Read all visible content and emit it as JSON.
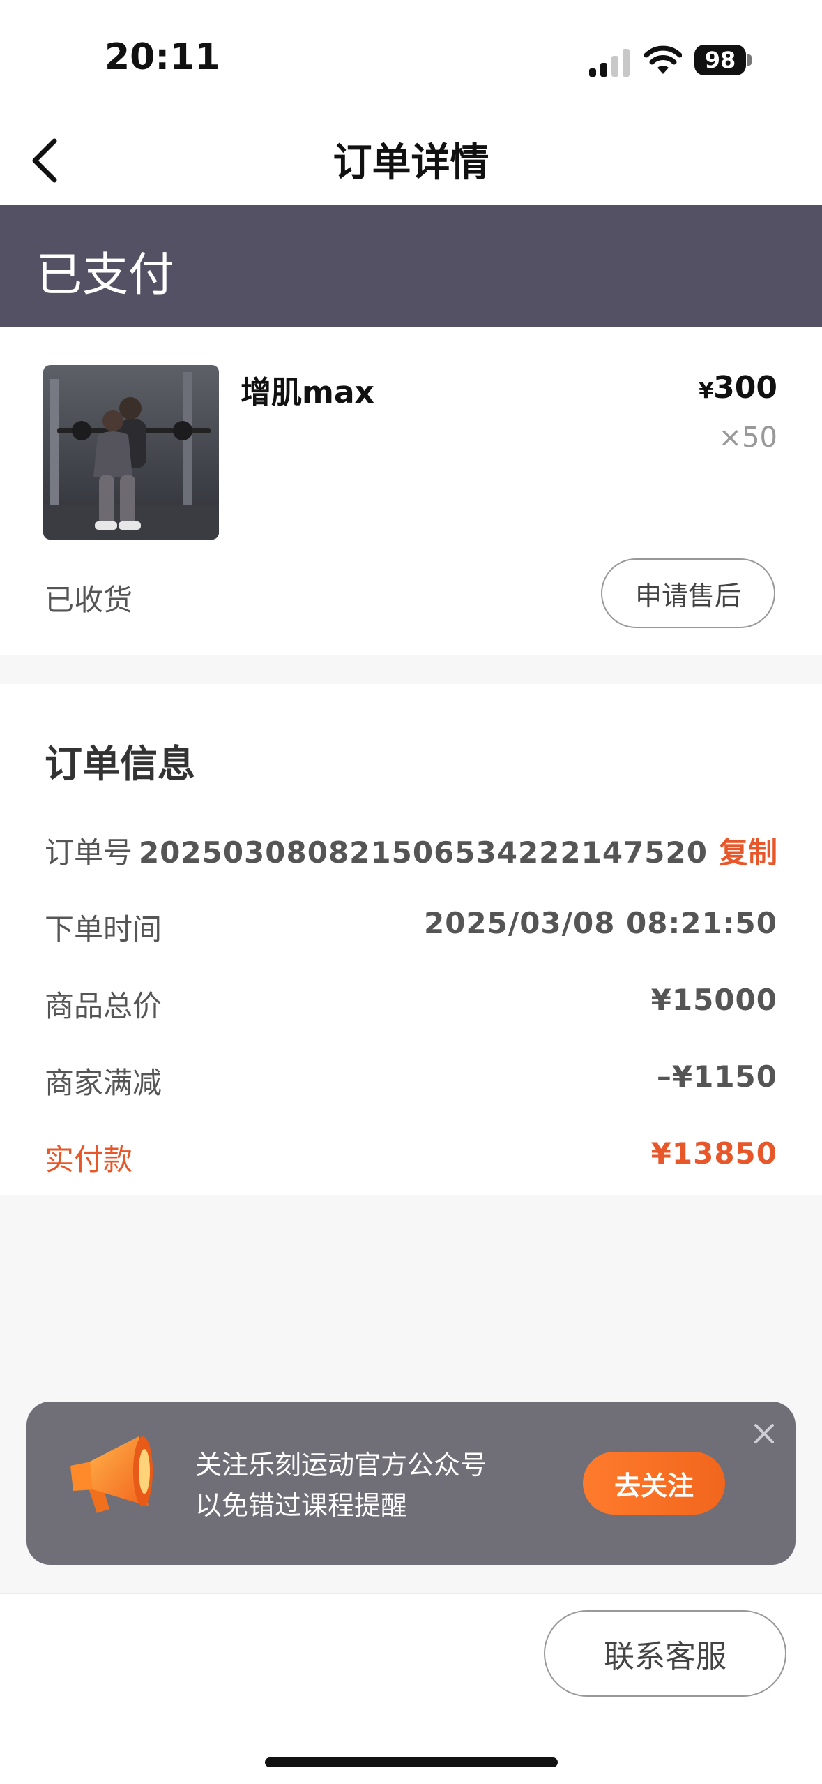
{
  "status_bar": {
    "time": "20:11",
    "battery": "98"
  },
  "nav": {
    "title": "订单详情"
  },
  "order_status": "已支付",
  "product": {
    "name": "增肌max",
    "currency": "¥",
    "price": "300",
    "quantity": "×50",
    "delivery_status": "已收货",
    "after_sale_label": "申请售后"
  },
  "order_info": {
    "title": "订单信息",
    "rows": [
      {
        "label": "订单号",
        "value": "20250308082150653422214752​0",
        "action": "复制"
      },
      {
        "label": "下单时间",
        "value": "2025/03/08 08:21:50"
      },
      {
        "label": "商品总价",
        "value": "¥15000"
      },
      {
        "label": "商家满减",
        "value": "–¥1150"
      },
      {
        "label": "实付款",
        "value": "¥13850"
      }
    ]
  },
  "banner": {
    "line1": "关注乐刻运动官方公众号",
    "line2": "以免错过课程提醒",
    "follow_label": "去关注"
  },
  "footer": {
    "contact_label": "联系客服"
  },
  "colors": {
    "accent": "#e8572a",
    "status_band": "#555164",
    "banner_bg": "#706e77"
  }
}
